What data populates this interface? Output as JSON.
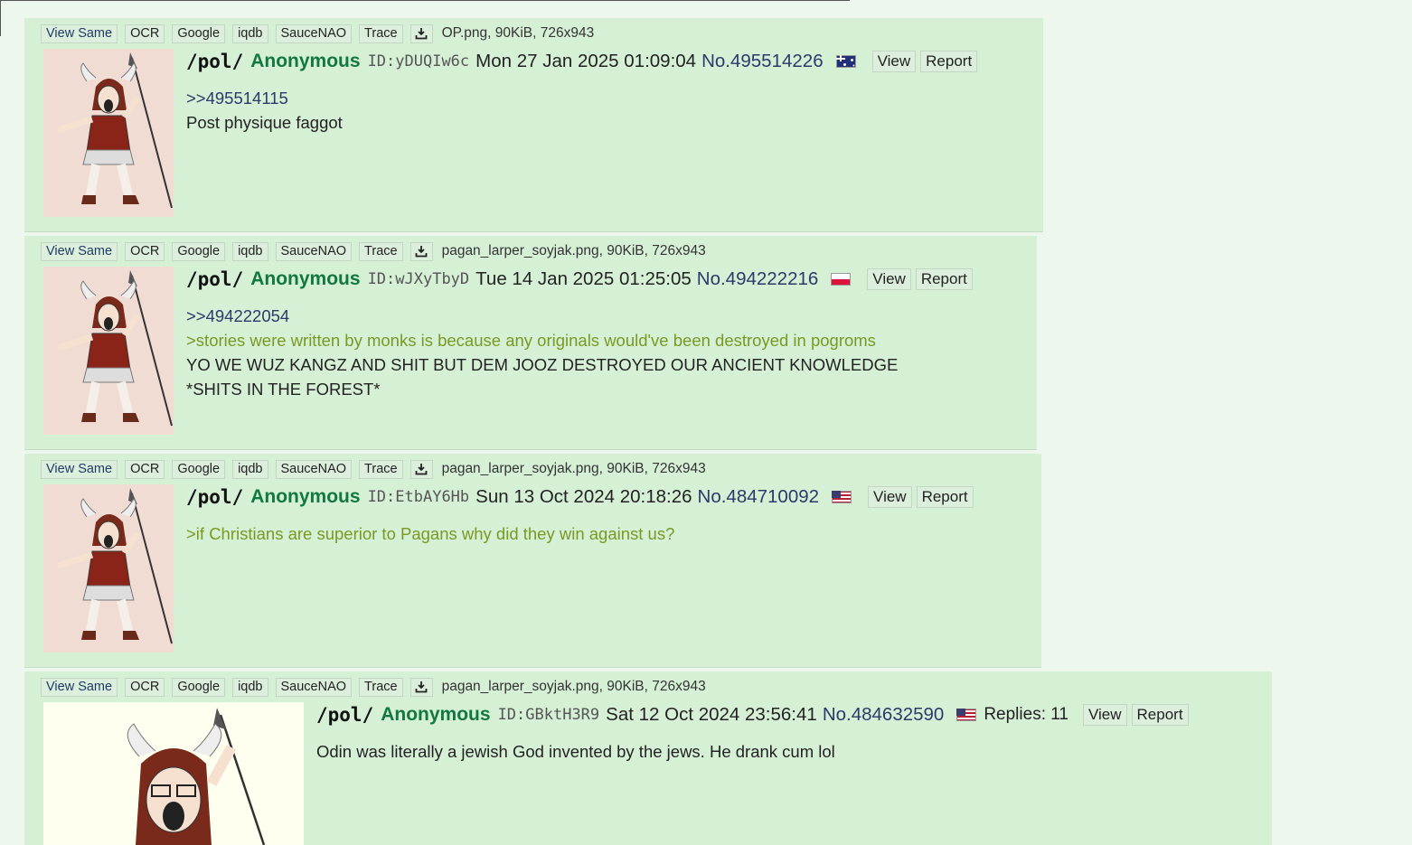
{
  "toolbar_buttons": {
    "view_same": "View Same",
    "ocr": "OCR",
    "google": "Google",
    "iqdb": "iqdb",
    "saucenao": "SauceNAO",
    "trace": "Trace",
    "download_icon": "download-icon"
  },
  "action_buttons": {
    "view": "View",
    "report": "Report"
  },
  "posts": [
    {
      "fileinfo": "OP.png, 90KiB, 726x943",
      "board": "/pol/",
      "name": "Anonymous",
      "id": "ID:yDUQIw6c",
      "date": "Mon 27 Jan 2025 01:09:04",
      "no": "No.495514226",
      "flag": "australia-flag",
      "quotelink": ">>495514115",
      "body": [
        "Post physique faggot"
      ]
    },
    {
      "fileinfo": "pagan_larper_soyjak.png, 90KiB, 726x943",
      "board": "/pol/",
      "name": "Anonymous",
      "id": "ID:wJXyTbyD",
      "date": "Tue 14 Jan 2025 01:25:05",
      "no": "No.494222216",
      "flag": "poland-flag",
      "quotelink": ">>494222054",
      "greentext": ">stories were written by monks is because any originals would've been destroyed in pogroms",
      "body": [
        "YO WE WUZ KANGZ AND SHIT BUT DEM JOOZ DESTROYED OUR ANCIENT KNOWLEDGE",
        "*SHITS IN THE FOREST*"
      ]
    },
    {
      "fileinfo": "pagan_larper_soyjak.png, 90KiB, 726x943",
      "board": "/pol/",
      "name": "Anonymous",
      "id": "ID:EtbAY6Hb",
      "date": "Sun 13 Oct 2024 20:18:26",
      "no": "No.484710092",
      "flag": "usa-flag",
      "greentext": ">if Christians are superior to Pagans why did they win against us?"
    },
    {
      "fileinfo": "pagan_larper_soyjak.png, 90KiB, 726x943",
      "board": "/pol/",
      "name": "Anonymous",
      "id": "ID:GBktH3R9",
      "date": "Sat 12 Oct 2024 23:56:41",
      "no": "No.484632590",
      "flag": "usa-flag",
      "replies": "Replies: 11",
      "body": [
        "Odin was literally a jewish God invented by the jews. He drank cum lol"
      ]
    }
  ]
}
